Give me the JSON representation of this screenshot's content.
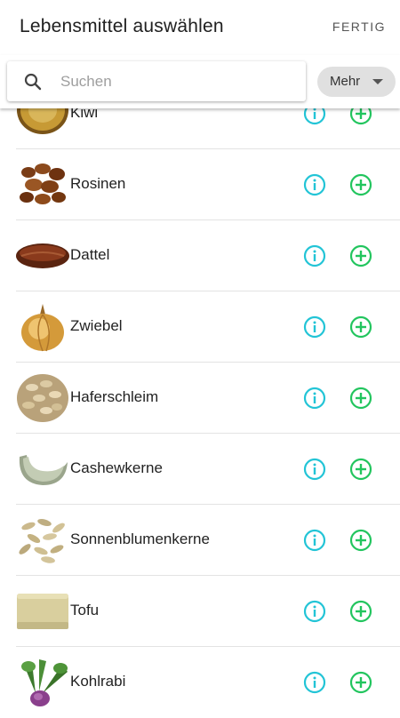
{
  "header": {
    "title": "Lebensmittel auswählen",
    "done_label": "FERTIG"
  },
  "search": {
    "placeholder": "Suchen",
    "value": "",
    "more_label": "Mehr"
  },
  "colors": {
    "info": "#22c4d6",
    "add": "#22c55e"
  },
  "items": [
    {
      "name": "Kiwi",
      "image": "kiwi"
    },
    {
      "name": "Rosinen",
      "image": "raisins"
    },
    {
      "name": "Dattel",
      "image": "date"
    },
    {
      "name": "Zwiebel",
      "image": "onion"
    },
    {
      "name": "Haferschleim",
      "image": "oats"
    },
    {
      "name": "Cashewkerne",
      "image": "cashew"
    },
    {
      "name": "Sonnenblumenkerne",
      "image": "sunflower-seeds"
    },
    {
      "name": "Tofu",
      "image": "tofu"
    },
    {
      "name": "Kohlrabi",
      "image": "kohlrabi"
    }
  ]
}
